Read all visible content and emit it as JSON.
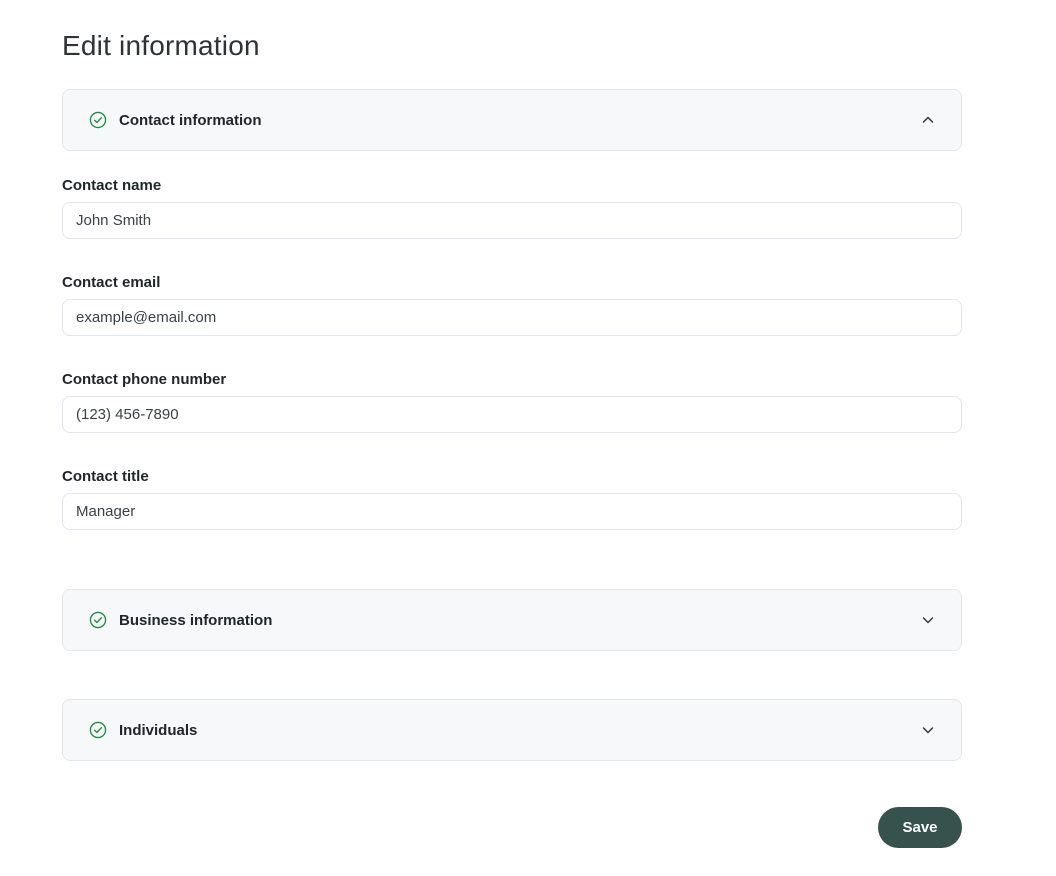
{
  "page": {
    "title": "Edit information"
  },
  "sections": [
    {
      "label": "Contact information",
      "state": "expanded",
      "status_icon": "checkmark-circle",
      "chevron_icon": "chevron-up-icon"
    },
    {
      "label": "Business information",
      "state": "collapsed",
      "status_icon": "checkmark-circle",
      "chevron_icon": "chevron-down-icon"
    },
    {
      "label": "Individuals",
      "state": "collapsed",
      "status_icon": "checkmark-circle",
      "chevron_icon": "chevron-down-icon"
    }
  ],
  "fields": [
    {
      "label": "Contact name",
      "value": "John Smith"
    },
    {
      "label": "Contact email",
      "value": "example@email.com"
    },
    {
      "label": "Contact phone number",
      "value": "(123) 456-7890"
    },
    {
      "label": "Contact title",
      "value": "Manager"
    }
  ],
  "footer": {
    "save_label": "Save"
  },
  "colors": {
    "check_green": "#1e8e3e",
    "save_button_bg": "#35524d",
    "accordion_bg": "#f7f8f9",
    "accordion_border": "#e4e7ea",
    "input_border": "#e1e5ee"
  }
}
